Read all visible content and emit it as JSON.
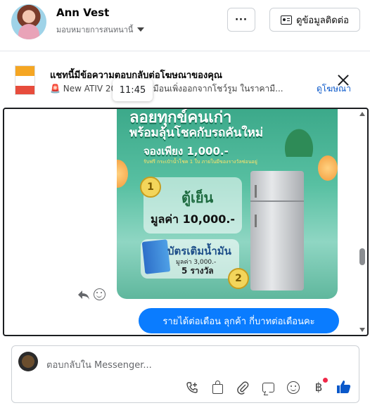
{
  "header": {
    "name": "Ann Vest",
    "assign_label": "มอบหมายการสนทนานี้",
    "more_label": "···",
    "contact_label": "ดูข้อมูลติดต่อ"
  },
  "ad_banner": {
    "title": "แชทนี้มีข้อความตอบกลับต่อโฆษณาของคุณ",
    "subtitle": "🚨 New ATIV 20 สดใหม่เหมือนเพิ่งออกจากโชว์รูม ในราคามื...",
    "view_ad_label": "ดูโฆษณา",
    "tooltip_time": "11:45"
  },
  "ad_image": {
    "headline": "ลอยทุกข์คนเก่า",
    "headline2": "พร้อมลุ้นโชคกับรถคันใหม่",
    "headline3": "จองเพียง 1,000.-",
    "small_text": "รับฟรี กระเป๋าน้ำโชค 1 ใบ ภายในมีของรางวัลซ่อนอยู่",
    "prize_title": "ตู้เย็น",
    "prize_value": "มูลค่า 10,000.-",
    "badge1": "1",
    "badge2": "2",
    "voucher_title": "บัตรเติมน้ำมัน",
    "voucher_value": "มูลค่า 3,000.-",
    "voucher_count": "5 รางวัล"
  },
  "message": {
    "outgoing_text": "รายได้ต่อเดือน  ลุกค้า  กี่บาทต่อเดือนคะ"
  },
  "composer": {
    "placeholder": "ตอบกลับใน Messenger...",
    "baht_symbol": "฿"
  },
  "colors": {
    "accent": "#0a7cff",
    "link": "#0a58ca",
    "notification_dot": "#f02849"
  },
  "icons": [
    "more-icon",
    "contact-card-icon",
    "close-icon",
    "reply-icon",
    "react-icon",
    "call-add-icon",
    "bag-icon",
    "attachment-icon",
    "saved-reply-icon",
    "emoji-icon",
    "baht-icon",
    "like-icon"
  ]
}
